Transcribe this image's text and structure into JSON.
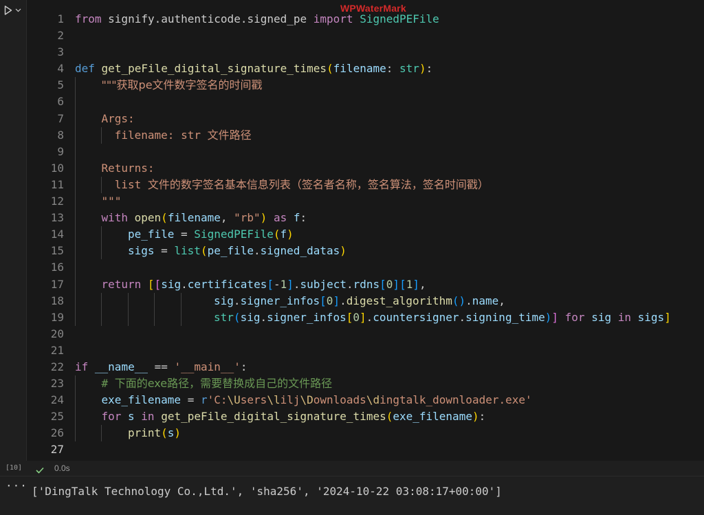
{
  "watermark": "WPWaterMark",
  "cell": {
    "execution_count": "[10]",
    "exec_time": "0.0s",
    "lines": [
      {
        "num": "1",
        "indent": 0,
        "tokens": [
          {
            "t": "from",
            "c": "k"
          },
          {
            "t": " signify.authenticode.signed_pe ",
            "c": ""
          },
          {
            "t": "import",
            "c": "k"
          },
          {
            "t": " ",
            "c": ""
          },
          {
            "t": "SignedPEFile",
            "c": "cls"
          }
        ]
      },
      {
        "num": "2",
        "indent": 0,
        "tokens": []
      },
      {
        "num": "3",
        "indent": 0,
        "tokens": []
      },
      {
        "num": "4",
        "indent": 0,
        "tokens": [
          {
            "t": "def",
            "c": "kd"
          },
          {
            "t": " ",
            "c": ""
          },
          {
            "t": "get_peFile_digital_signature_times",
            "c": "fn"
          },
          {
            "t": "(",
            "c": "p1"
          },
          {
            "t": "filename",
            "c": "v"
          },
          {
            "t": ": ",
            "c": ""
          },
          {
            "t": "str",
            "c": "cls"
          },
          {
            "t": ")",
            "c": "p1"
          },
          {
            "t": ":",
            "c": ""
          }
        ]
      },
      {
        "num": "5",
        "indent": 1,
        "tokens": [
          {
            "t": "\"\"\"获取pe文件数字签名的时间戳",
            "c": "s cjk"
          }
        ]
      },
      {
        "num": "6",
        "indent": 1,
        "tokens": []
      },
      {
        "num": "7",
        "indent": 1,
        "tokens": [
          {
            "t": "Args:",
            "c": "s"
          }
        ]
      },
      {
        "num": "8",
        "indent": 1,
        "extra_indent": true,
        "tokens": [
          {
            "t": "  filename: str ",
            "c": "s"
          },
          {
            "t": "文件路径",
            "c": "s cjk"
          }
        ]
      },
      {
        "num": "9",
        "indent": 1,
        "tokens": []
      },
      {
        "num": "10",
        "indent": 1,
        "tokens": [
          {
            "t": "Returns:",
            "c": "s"
          }
        ]
      },
      {
        "num": "11",
        "indent": 1,
        "extra_indent": true,
        "tokens": [
          {
            "t": "  list ",
            "c": "s"
          },
          {
            "t": "文件的数字签名基本信息列表（签名者名称，签名算法，签名时间戳）",
            "c": "s cjk"
          }
        ]
      },
      {
        "num": "12",
        "indent": 1,
        "tokens": [
          {
            "t": "\"\"\"",
            "c": "s"
          }
        ]
      },
      {
        "num": "13",
        "indent": 1,
        "tokens": [
          {
            "t": "with",
            "c": "k"
          },
          {
            "t": " ",
            "c": ""
          },
          {
            "t": "open",
            "c": "fn"
          },
          {
            "t": "(",
            "c": "p1"
          },
          {
            "t": "filename",
            "c": "v"
          },
          {
            "t": ", ",
            "c": ""
          },
          {
            "t": "\"rb\"",
            "c": "s"
          },
          {
            "t": ")",
            "c": "p1"
          },
          {
            "t": " ",
            "c": ""
          },
          {
            "t": "as",
            "c": "k"
          },
          {
            "t": " ",
            "c": ""
          },
          {
            "t": "f",
            "c": "v"
          },
          {
            "t": ":",
            "c": ""
          }
        ]
      },
      {
        "num": "14",
        "indent": 2,
        "tokens": [
          {
            "t": "pe_file",
            "c": "v"
          },
          {
            "t": " = ",
            "c": ""
          },
          {
            "t": "SignedPEFile",
            "c": "cls"
          },
          {
            "t": "(",
            "c": "p1"
          },
          {
            "t": "f",
            "c": "v"
          },
          {
            "t": ")",
            "c": "p1"
          }
        ]
      },
      {
        "num": "15",
        "indent": 2,
        "tokens": [
          {
            "t": "sigs",
            "c": "v"
          },
          {
            "t": " = ",
            "c": ""
          },
          {
            "t": "list",
            "c": "cls"
          },
          {
            "t": "(",
            "c": "p1"
          },
          {
            "t": "pe_file",
            "c": "v"
          },
          {
            "t": ".",
            "c": ""
          },
          {
            "t": "signed_datas",
            "c": "v"
          },
          {
            "t": ")",
            "c": "p1"
          }
        ]
      },
      {
        "num": "16",
        "indent": 1,
        "tokens": []
      },
      {
        "num": "17",
        "indent": 1,
        "tokens": [
          {
            "t": "return",
            "c": "k"
          },
          {
            "t": " ",
            "c": ""
          },
          {
            "t": "[",
            "c": "p1"
          },
          {
            "t": "[",
            "c": "p2"
          },
          {
            "t": "sig",
            "c": "v"
          },
          {
            "t": ".",
            "c": ""
          },
          {
            "t": "certificates",
            "c": "v"
          },
          {
            "t": "[",
            "c": "p3"
          },
          {
            "t": "-",
            "c": ""
          },
          {
            "t": "1",
            "c": "n"
          },
          {
            "t": "]",
            "c": "p3"
          },
          {
            "t": ".",
            "c": ""
          },
          {
            "t": "subject",
            "c": "v"
          },
          {
            "t": ".",
            "c": ""
          },
          {
            "t": "rdns",
            "c": "v"
          },
          {
            "t": "[",
            "c": "p3"
          },
          {
            "t": "0",
            "c": "n"
          },
          {
            "t": "]",
            "c": "p3"
          },
          {
            "t": "[",
            "c": "p3"
          },
          {
            "t": "1",
            "c": "n"
          },
          {
            "t": "]",
            "c": "p3"
          },
          {
            "t": ",",
            "c": ""
          }
        ]
      },
      {
        "num": "18",
        "indent": 5,
        "pad": 1,
        "tokens": [
          {
            "t": "sig",
            "c": "v"
          },
          {
            "t": ".",
            "c": ""
          },
          {
            "t": "signer_infos",
            "c": "v"
          },
          {
            "t": "[",
            "c": "p3"
          },
          {
            "t": "0",
            "c": "n"
          },
          {
            "t": "]",
            "c": "p3"
          },
          {
            "t": ".",
            "c": ""
          },
          {
            "t": "digest_algorithm",
            "c": "fn"
          },
          {
            "t": "()",
            "c": "p3"
          },
          {
            "t": ".",
            "c": ""
          },
          {
            "t": "name",
            "c": "v"
          },
          {
            "t": ",",
            "c": ""
          }
        ]
      },
      {
        "num": "19",
        "indent": 5,
        "pad": 1,
        "tokens": [
          {
            "t": "str",
            "c": "cls"
          },
          {
            "t": "(",
            "c": "p3"
          },
          {
            "t": "sig",
            "c": "v"
          },
          {
            "t": ".",
            "c": ""
          },
          {
            "t": "signer_infos",
            "c": "v"
          },
          {
            "t": "[",
            "c": "p1"
          },
          {
            "t": "0",
            "c": "n"
          },
          {
            "t": "]",
            "c": "p1"
          },
          {
            "t": ".",
            "c": ""
          },
          {
            "t": "countersigner",
            "c": "v"
          },
          {
            "t": ".",
            "c": ""
          },
          {
            "t": "signing_time",
            "c": "v"
          },
          {
            "t": ")",
            "c": "p3"
          },
          {
            "t": "]",
            "c": "p2"
          },
          {
            "t": " ",
            "c": ""
          },
          {
            "t": "for",
            "c": "k"
          },
          {
            "t": " ",
            "c": ""
          },
          {
            "t": "sig",
            "c": "v"
          },
          {
            "t": " ",
            "c": ""
          },
          {
            "t": "in",
            "c": "k"
          },
          {
            "t": " ",
            "c": ""
          },
          {
            "t": "sigs",
            "c": "v"
          },
          {
            "t": "]",
            "c": "p1"
          }
        ]
      },
      {
        "num": "20",
        "indent": 0,
        "tokens": []
      },
      {
        "num": "21",
        "indent": 0,
        "tokens": []
      },
      {
        "num": "22",
        "indent": 0,
        "tokens": [
          {
            "t": "if",
            "c": "k"
          },
          {
            "t": " ",
            "c": ""
          },
          {
            "t": "__name__",
            "c": "v"
          },
          {
            "t": " == ",
            "c": ""
          },
          {
            "t": "'__main__'",
            "c": "s"
          },
          {
            "t": ":",
            "c": ""
          }
        ]
      },
      {
        "num": "23",
        "indent": 1,
        "tokens": [
          {
            "t": "# ",
            "c": "c"
          },
          {
            "t": "下面的exe路径，需要替换成自己的文件路径",
            "c": "c cjk"
          }
        ]
      },
      {
        "num": "24",
        "indent": 1,
        "tokens": [
          {
            "t": "exe_filename",
            "c": "v"
          },
          {
            "t": " = ",
            "c": ""
          },
          {
            "t": "r",
            "c": "kd"
          },
          {
            "t": "'C:",
            "c": "s"
          },
          {
            "t": "\\U",
            "c": "esc"
          },
          {
            "t": "sers",
            "c": "s"
          },
          {
            "t": "\\l",
            "c": "esc"
          },
          {
            "t": "ilj",
            "c": "s"
          },
          {
            "t": "\\D",
            "c": "esc"
          },
          {
            "t": "ownloads",
            "c": "s"
          },
          {
            "t": "\\d",
            "c": "esc"
          },
          {
            "t": "ingtalk_downloader.exe'",
            "c": "s"
          }
        ]
      },
      {
        "num": "25",
        "indent": 1,
        "tokens": [
          {
            "t": "for",
            "c": "k"
          },
          {
            "t": " ",
            "c": ""
          },
          {
            "t": "s",
            "c": "v"
          },
          {
            "t": " ",
            "c": ""
          },
          {
            "t": "in",
            "c": "k"
          },
          {
            "t": " ",
            "c": ""
          },
          {
            "t": "get_peFile_digital_signature_times",
            "c": "fn"
          },
          {
            "t": "(",
            "c": "p1"
          },
          {
            "t": "exe_filename",
            "c": "v"
          },
          {
            "t": ")",
            "c": "p1"
          },
          {
            "t": ":",
            "c": ""
          }
        ]
      },
      {
        "num": "26",
        "indent": 2,
        "tokens": [
          {
            "t": "print",
            "c": "fn"
          },
          {
            "t": "(",
            "c": "p1"
          },
          {
            "t": "s",
            "c": "v"
          },
          {
            "t": ")",
            "c": "p1"
          }
        ]
      },
      {
        "num": "27",
        "indent": 0,
        "active": true,
        "tokens": []
      }
    ]
  },
  "output": {
    "more_label": "···",
    "text": "['DingTalk Technology Co.,Ltd.', 'sha256', '2024-10-22 03:08:17+00:00']"
  },
  "icons": {
    "run": "play-icon",
    "run_menu": "chevron-down-icon",
    "status": "check-icon"
  },
  "colors": {
    "editor_bg": "#181818",
    "panel_bg": "#1f1f1f",
    "keyword": "#c586c0",
    "function": "#dcdcaa",
    "variable": "#9cdcfe",
    "string": "#ce9178",
    "comment": "#6a9955",
    "success": "#89d185"
  }
}
